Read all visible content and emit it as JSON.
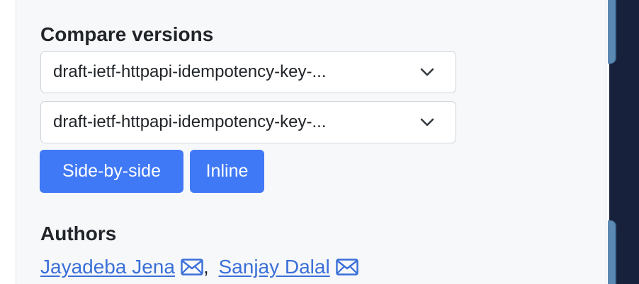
{
  "compare": {
    "heading": "Compare versions",
    "select_from": "draft-ietf-httpapi-idempotency-key-...",
    "select_to": "draft-ietf-httpapi-idempotency-key-...",
    "side_by_side_label": "Side-by-side",
    "inline_label": "Inline"
  },
  "authors": {
    "heading": "Authors",
    "list": [
      {
        "name": "Jayadeba Jena",
        "icon": "envelope-icon"
      },
      {
        "name": "Sanjay Dalal",
        "icon": "envelope-icon"
      }
    ],
    "separator": ","
  },
  "colors": {
    "primary_button": "#4079f6",
    "link": "#3a6fd8",
    "panel_bg": "#f7f8fa",
    "side_dark": "#17213c"
  }
}
